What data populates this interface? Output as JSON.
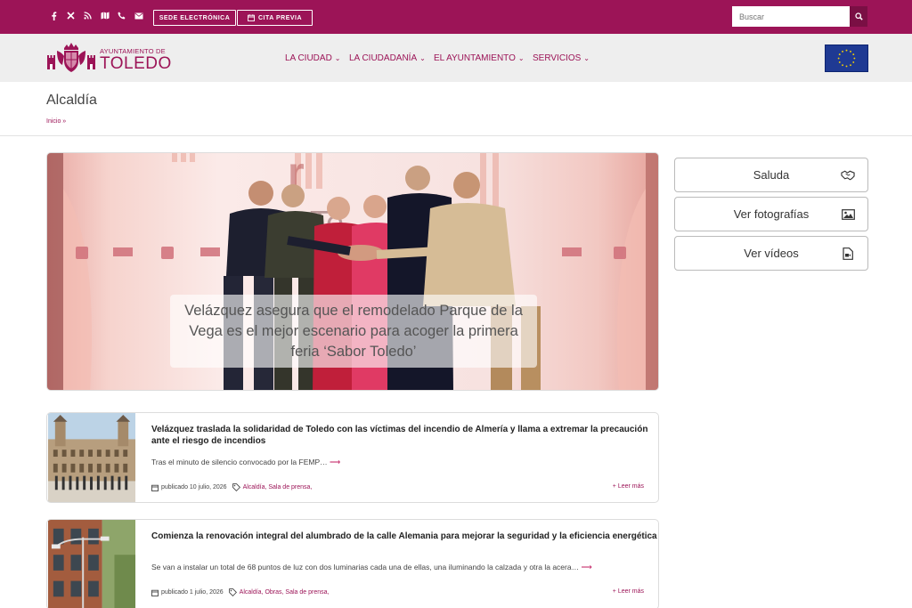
{
  "topbar": {
    "social_icons": [
      "facebook-icon",
      "x-icon",
      "rss-icon",
      "map-icon",
      "phone-icon",
      "mail-icon"
    ],
    "buttons": {
      "sede": "SEDE ELECTRÓNICA",
      "cita": "CITA PREVIA"
    },
    "search_placeholder": "Buscar"
  },
  "logo": {
    "small": "AYUNTAMIENTO DE",
    "big": "TOLEDO"
  },
  "nav": [
    {
      "label": "LA CIUDAD"
    },
    {
      "label": "LA CIUDADANÍA"
    },
    {
      "label": "EL AYUNTAMIENTO"
    },
    {
      "label": "SERVICIOS"
    }
  ],
  "page": {
    "title": "Alcaldía",
    "breadcrumb": "Inicio »"
  },
  "hero": {
    "caption": "Velázquez asegura que el remodelado Parque de la Vega es el mejor escenario para acoger la primera feria ‘Sabor Toledo’"
  },
  "sidebar": [
    {
      "label": "Saluda",
      "icon": "handshake-icon"
    },
    {
      "label": "Ver fotografías",
      "icon": "image-icon"
    },
    {
      "label": "Ver vídeos",
      "icon": "video-file-icon"
    }
  ],
  "news": [
    {
      "title": "Velázquez traslada la solidaridad de Toledo con las víctimas del incendio de Almería y llama a extremar la precaución ante el riesgo de incendios",
      "excerpt": "Tras el minuto de silencio convocado por la FEMP…",
      "date": "publicado 10 julio, 2026",
      "categories": "Alcaldía, Sala de prensa,",
      "more": "+ Leer más"
    },
    {
      "title": "Comienza la renovación integral del alumbrado de la calle Alemania para mejorar la seguridad y la eficiencia energética",
      "excerpt": "Se van a instalar un total de 68 puntos de luz con dos luminarias cada una de ellas, una iluminando la calzada y otra la acera…",
      "date": "publicado 1 julio, 2026",
      "categories": "Alcaldía, Obras, Sala de prensa,",
      "more": "+ Leer más"
    }
  ],
  "colors": {
    "brand": "#9c1457",
    "brand_dark": "#7a0f44",
    "eu_blue": "#1f3a93",
    "eu_star": "#f5d000"
  }
}
